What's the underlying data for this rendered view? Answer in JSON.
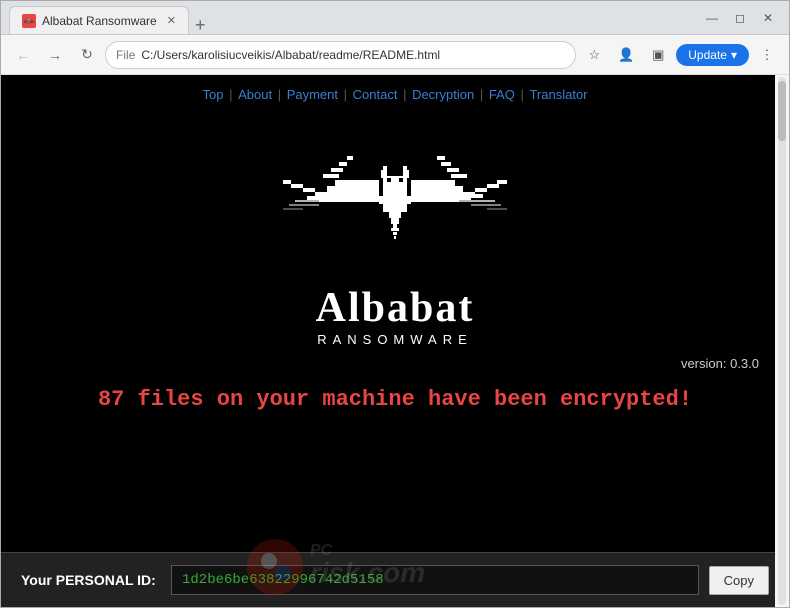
{
  "window": {
    "title": "Albabat Ransomware",
    "tab_label": "Albabat Ransomware"
  },
  "browser": {
    "url": "C:/Users/karolisiucveikis/Albabat/readme/README.html",
    "file_label": "File",
    "update_button": "Update",
    "back_tooltip": "Back",
    "forward_tooltip": "Forward",
    "reload_tooltip": "Reload"
  },
  "nav_links": {
    "items": [
      "Top",
      "About",
      "Payment",
      "Contact",
      "Decryption",
      "FAQ",
      "Translator"
    ],
    "separator": "|"
  },
  "brand": {
    "name": "Albabat",
    "subtitle": "RANSOMWARE",
    "version": "version: 0.3.0"
  },
  "warning": {
    "text": "87 files on your machine have been encrypted!"
  },
  "personal_id": {
    "label": "Your PERSONAL ID:",
    "value": "1d2be6be63822996742d5158",
    "copy_button": "Copy"
  },
  "colors": {
    "warning_red": "#e84545",
    "id_green": "#33aa33",
    "page_bg": "#000000",
    "accent_blue": "#1a73e8"
  }
}
